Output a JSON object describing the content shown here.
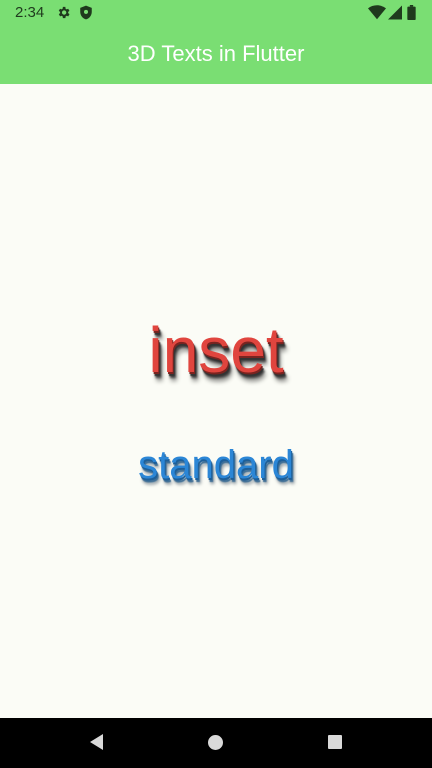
{
  "status_bar": {
    "time": "2:34",
    "icons": [
      "gear-icon",
      "shield-icon",
      "wifi-icon",
      "signal-icon",
      "battery-icon"
    ]
  },
  "app_bar": {
    "title": "3D Texts in Flutter",
    "color": "#7ade73"
  },
  "content": {
    "inset_text": "inset",
    "inset_color": "#e0453e",
    "standard_text": "standard",
    "standard_color": "#2b86d6",
    "background": "#fbfcf6"
  },
  "nav_bar": {
    "buttons": [
      "back-icon",
      "home-icon",
      "recents-icon"
    ]
  }
}
